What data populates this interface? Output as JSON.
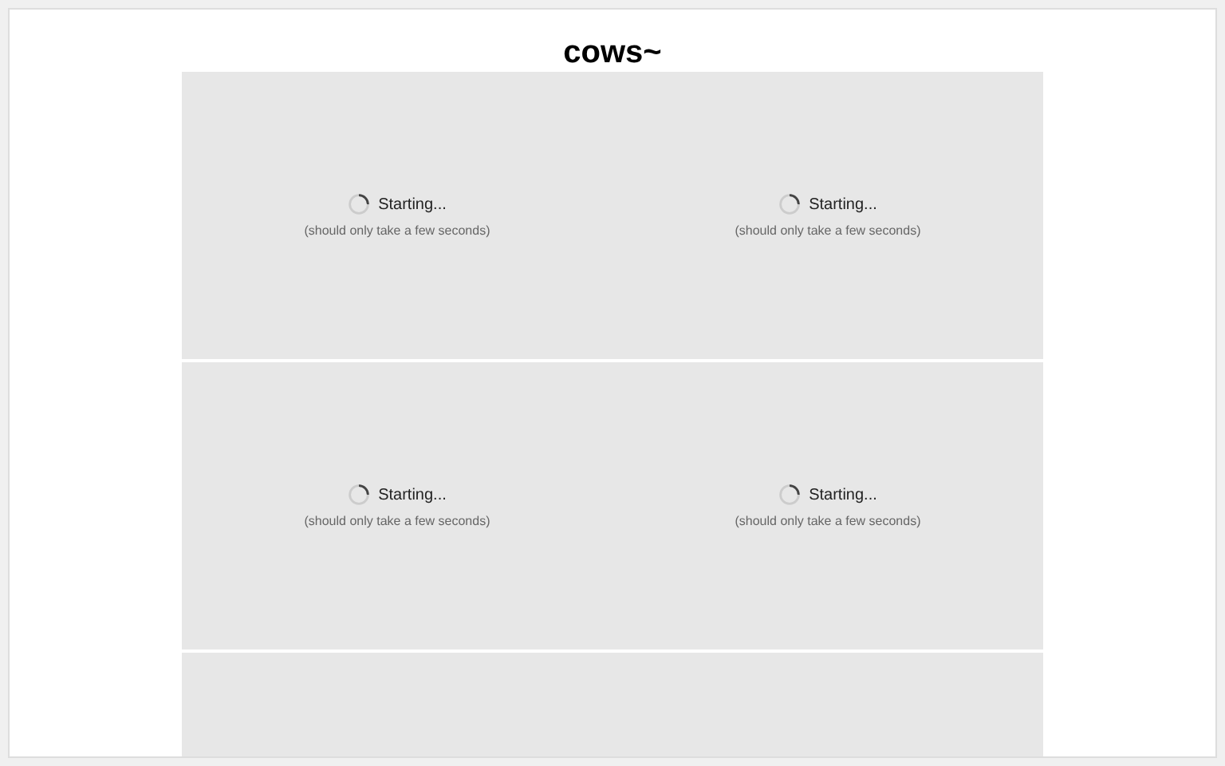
{
  "title": "cows~",
  "panels": [
    {
      "kind": "loading",
      "cells": [
        {
          "status": "Starting...",
          "note": "(should only take a few seconds)"
        },
        {
          "status": "Starting...",
          "note": "(should only take a few seconds)"
        }
      ]
    },
    {
      "kind": "loading",
      "cells": [
        {
          "status": "Starting...",
          "note": "(should only take a few seconds)"
        },
        {
          "status": "Starting...",
          "note": "(should only take a few seconds)"
        }
      ]
    },
    {
      "kind": "blank"
    }
  ]
}
